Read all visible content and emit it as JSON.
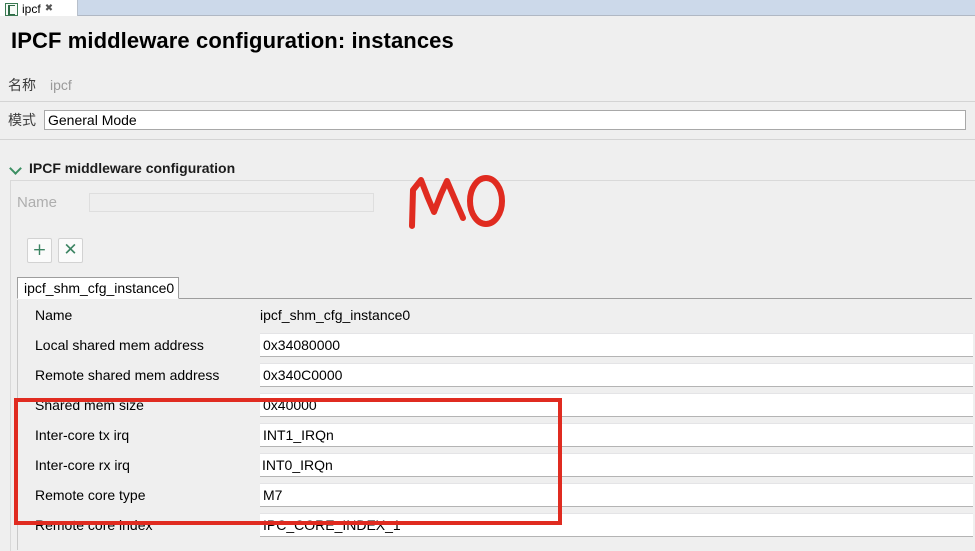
{
  "editor_tab": {
    "icon": "file-config-icon",
    "label": "ipcf",
    "close": "✖"
  },
  "page_title": "IPCF middleware configuration: instances",
  "header_fields": [
    {
      "label": "名称",
      "value": "ipcf",
      "readonly": true
    },
    {
      "label": "模式",
      "value": "General Mode",
      "readonly": false
    }
  ],
  "section": {
    "expander_icon": "chevron-down-icon",
    "title": "IPCF middleware configuration",
    "name_filter": {
      "label": "Name",
      "value": "",
      "placeholder": ""
    },
    "toolbar": [
      {
        "name": "add-instance-button",
        "icon": "plus-icon",
        "glyph": "+"
      },
      {
        "name": "remove-instance-button",
        "icon": "close-x-icon",
        "glyph": "✕"
      }
    ],
    "instance_tabs": [
      {
        "label": "ipcf_shm_cfg_instance0",
        "selected": true
      }
    ],
    "properties": [
      {
        "label": "Name",
        "value": "ipcf_shm_cfg_instance0",
        "editable": false,
        "caret": false
      },
      {
        "label": "Local shared mem address",
        "value": "0x34080000",
        "editable": true,
        "caret": false
      },
      {
        "label": "Remote shared mem address",
        "value": "0x340C0000",
        "editable": true,
        "caret": false
      },
      {
        "label": "Shared mem size",
        "value": "0x40000",
        "editable": true,
        "caret": false
      },
      {
        "label": "Inter-core tx irq",
        "value": "INT1_IRQn",
        "editable": true,
        "caret": false
      },
      {
        "label": "Inter-core rx irq",
        "value": "INT0_IRQn",
        "editable": true,
        "caret": true
      },
      {
        "label": "Remote core type",
        "value": "M7",
        "editable": true,
        "caret": false
      },
      {
        "label": "Remote core index",
        "value": "IPC_CORE_INDEX_1",
        "editable": true,
        "caret": false
      }
    ]
  },
  "annotations": {
    "highlight_box_color": "#e02b20",
    "handwriting_text": "M0",
    "handwriting_color": "#e02b20"
  }
}
